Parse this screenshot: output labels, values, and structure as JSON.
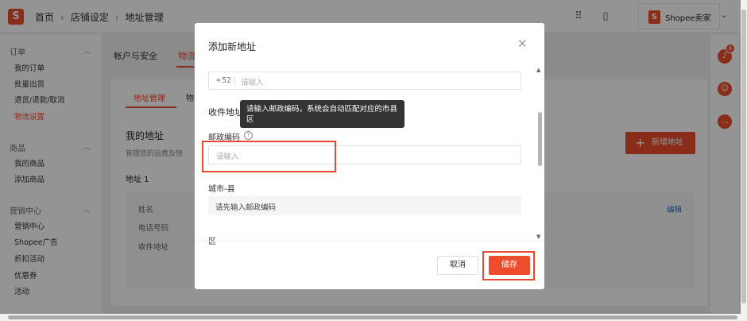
{
  "header": {
    "logo_letter": "S",
    "breadcrumbs": [
      "首页",
      "店铺设定",
      "地址管理"
    ],
    "seller_label": "Shopee卖家",
    "icons": [
      "apps-grid-icon",
      "book-icon",
      "chevron-down-icon"
    ]
  },
  "sidebar": {
    "groups": [
      {
        "label": "订单",
        "items": [
          "我的订单",
          "批量出货",
          "退货/退款/取消",
          "物流设置"
        ]
      },
      {
        "label": "商品",
        "items": [
          "我的商品",
          "添加商品"
        ]
      },
      {
        "label": "营销中心",
        "items": [
          "营销中心",
          "Shopee广告",
          "折扣活动",
          "优惠券",
          "活动"
        ]
      }
    ],
    "active_item": "物流设置"
  },
  "main": {
    "tabs": [
      "帐户与安全",
      "物流"
    ],
    "sub_tabs": [
      "地址管理",
      "物"
    ],
    "title": "我的地址",
    "description": "管理您的运费及快",
    "address_label": "地址 1",
    "fields": [
      "姓名",
      "电话号码",
      "收件地址"
    ],
    "edit_label": "编辑",
    "add_button": "新增地址"
  },
  "rail": {
    "notification_count": "6"
  },
  "modal": {
    "title": "添加新地址",
    "phone_prefix": "+52",
    "phone_placeholder": "请输入",
    "section_title": "收件地址",
    "tooltip": "请输入邮政编码，系统会自动匹配对应的市县区",
    "postal_label": "邮政编码",
    "postal_placeholder": "请输入",
    "city_label": "城市-县",
    "city_placeholder": "请先输入邮政编码",
    "district_label": "区",
    "cancel_label": "取消",
    "save_label": "储存"
  },
  "colors": {
    "brand": "#ee4d2d",
    "link": "#2673dd",
    "tooltip_bg": "#333333",
    "highlight": "#e64a2e"
  }
}
